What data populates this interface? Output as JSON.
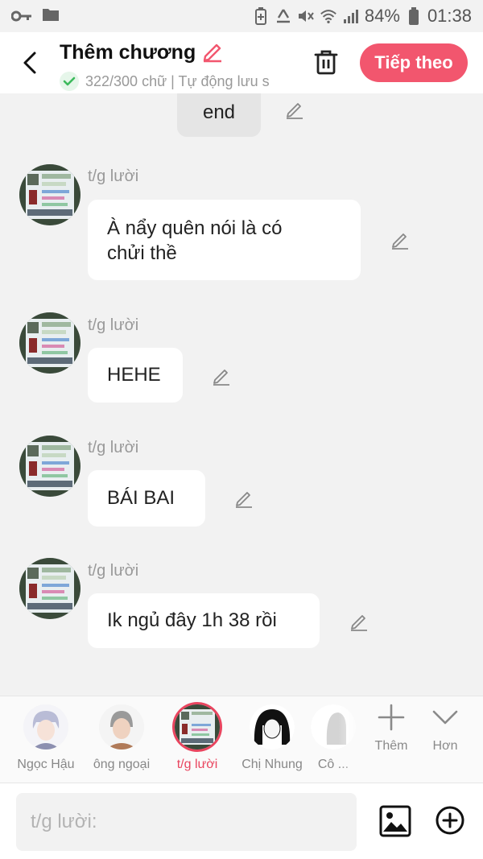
{
  "status_bar": {
    "battery": "84%",
    "time": "01:38"
  },
  "header": {
    "title": "Thêm chương",
    "subtitle": "322/300 chữ | Tự động lưu s",
    "next_label": "Tiếp theo"
  },
  "messages": [
    {
      "type": "narration",
      "text": "end"
    },
    {
      "sender": "t/g lười",
      "text_line1": "À  nẩy quên nói là có",
      "text_line2": "chửi thề"
    },
    {
      "sender": "t/g lười",
      "text": "HEHE"
    },
    {
      "sender": "t/g lười",
      "text": "BÁI BAI"
    },
    {
      "sender": "t/g lười",
      "text": "Ik ngủ đây 1h 38 rồi"
    }
  ],
  "characters": [
    {
      "name": "Ngọc Hậu"
    },
    {
      "name": "ông ngoại"
    },
    {
      "name": "t/g lười"
    },
    {
      "name": "Chị Nhung"
    },
    {
      "name": "Cô ..."
    }
  ],
  "tools": {
    "add_label": "Thêm",
    "more_label": "Hơn"
  },
  "input": {
    "placeholder": "t/g lười:"
  },
  "colors": {
    "accent": "#f2566e",
    "active_name": "#e9455f",
    "background": "#f2f2f2"
  }
}
